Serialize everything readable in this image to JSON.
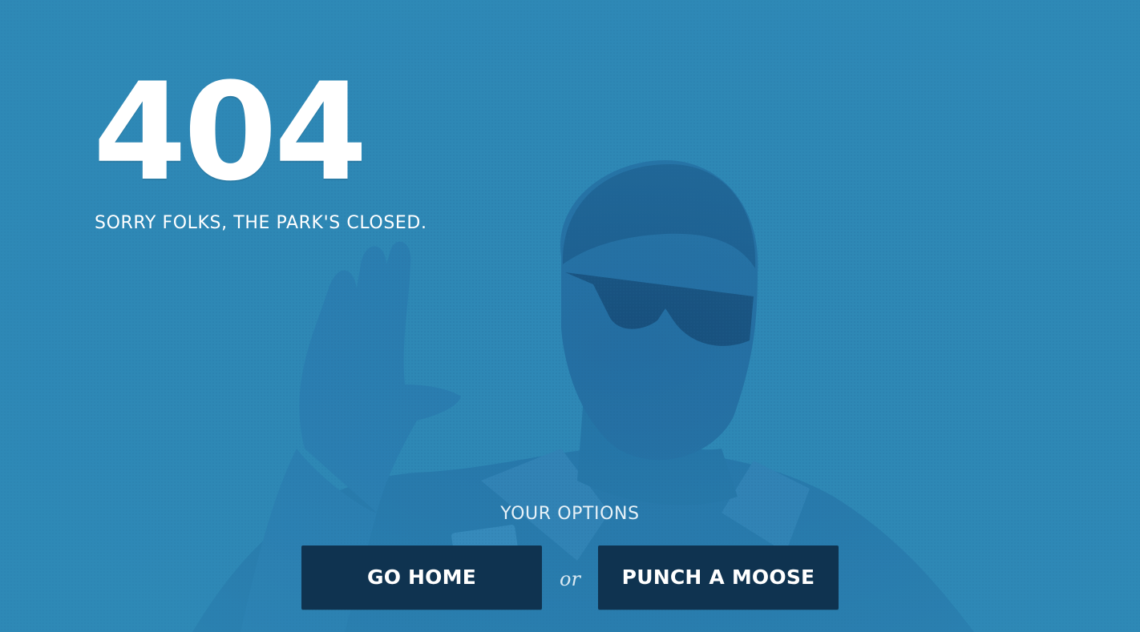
{
  "hero": {
    "code": "404",
    "message": "SORRY FOLKS, THE PARK'S CLOSED."
  },
  "options": {
    "heading": "YOUR OPTIONS",
    "separator": "or",
    "buttons": [
      {
        "label": "GO HOME"
      },
      {
        "label": "PUNCH A MOOSE"
      }
    ]
  },
  "colors": {
    "background": "#2e89b6",
    "button": "#0f3350",
    "text": "#ffffff"
  }
}
